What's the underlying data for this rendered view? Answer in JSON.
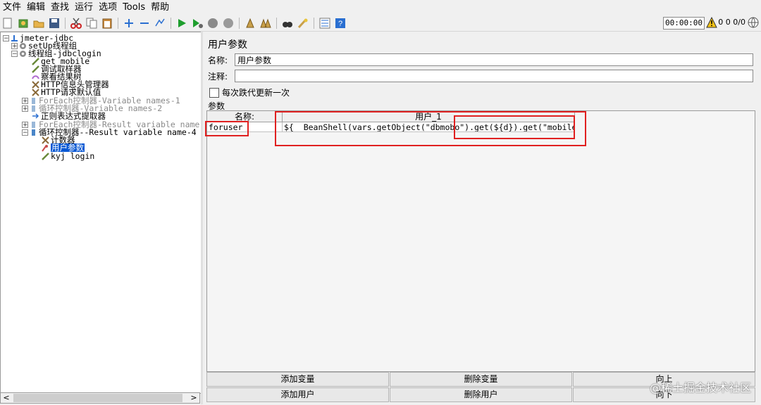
{
  "menu": [
    "文件",
    "编辑",
    "查找",
    "运行",
    "选项",
    "Tools",
    "帮助"
  ],
  "toolbar": {
    "icons": [
      "new-icon",
      "templates-icon",
      "open-icon",
      "save-icon",
      "cut-icon",
      "copy-icon",
      "paste-icon",
      "expand-icon",
      "collapse-icon",
      "toggle-icon",
      "start-icon",
      "start-no-pause-icon",
      "stop-icon",
      "shutdown-icon",
      "clear-icon",
      "clear-all-icon",
      "search-icon",
      "reset-search-icon",
      "function-helper-icon",
      "help-icon"
    ],
    "timer": "00:00:00",
    "warning_count": "0",
    "thread_counts": "0 0/0"
  },
  "tree": {
    "items": [
      {
        "label": "jmeter-jdbc",
        "icon": "testplan-icon"
      },
      {
        "label": "setUp线程组",
        "icon": "gear-icon"
      },
      {
        "label": "线程组-jdbclogin",
        "icon": "gear-icon"
      },
      {
        "label": "get mobile",
        "icon": "sampler-icon"
      },
      {
        "label": "调试取样器",
        "icon": "sampler-icon"
      },
      {
        "label": "察看结果树",
        "icon": "listener-icon"
      },
      {
        "label": "HTTP信息头管理器",
        "icon": "wrench-icon"
      },
      {
        "label": "HTTP请求默认值",
        "icon": "wrench-icon"
      },
      {
        "label": "ForEach控制器-Variable names-1",
        "icon": "controller-icon"
      },
      {
        "label": "循环控制器-Variable names-2",
        "icon": "controller-icon"
      },
      {
        "label": "正则表达式提取器",
        "icon": "extractor-icon"
      },
      {
        "label": "ForEach控制器-Result variable name-",
        "icon": "controller-icon"
      },
      {
        "label": "循环控制器--Result variable name-4",
        "icon": "controller-icon"
      },
      {
        "label": "计数器",
        "icon": "wrench-icon"
      },
      {
        "label": "用户参数",
        "icon": "preprocessor-icon"
      },
      {
        "label": "kyj login",
        "icon": "sampler-icon"
      }
    ]
  },
  "panel": {
    "title": "用户参数",
    "name_label": "名称:",
    "name_value": "用户参数",
    "comment_label": "注释:",
    "comment_value": "",
    "checkbox_label": "每次跌代更新一次",
    "params_label": "参数",
    "table": {
      "headers": [
        "名称:",
        "用户_1"
      ],
      "rows": [
        {
          "name": "foruser",
          "value": "${__BeanShell(vars.getObject(\"dbmobo\").get(${d}).get(\"mobile\"))}"
        }
      ]
    },
    "buttons": {
      "add_var": "添加变量",
      "del_var": "删除变量",
      "up": "向上",
      "add_user": "添加用户",
      "del_user": "删除用户",
      "down": "向下"
    }
  },
  "watermark": "@稀土掘金技术社区"
}
